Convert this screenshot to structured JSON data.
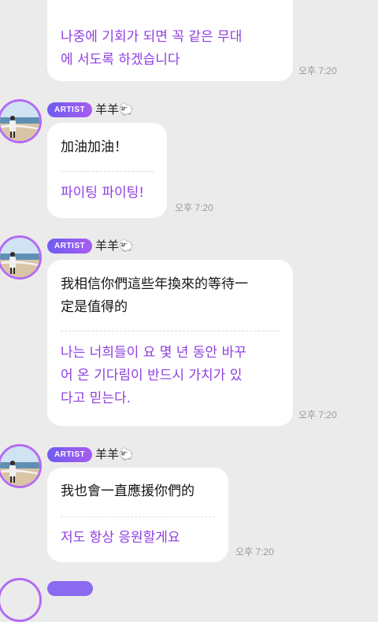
{
  "messages": [
    {
      "original": "",
      "translation": "나중에 기회가 되면 꼭 같은 무대\n에 서도록 하겠습니다",
      "time": "오후 7:20"
    },
    {
      "artist_badge": "ARTIST",
      "name": "羊羊🐑",
      "original": "加油加油！",
      "translation": "파이팅 파이팅!",
      "time": "오후 7:20"
    },
    {
      "artist_badge": "ARTIST",
      "name": "羊羊🐑",
      "original": "我相信你們這些年換來的等待一\n定是值得的",
      "translation": "나는 너희들이 요 몇 년 동안 바꾸\n어 온 기다림이 반드시 가치가 있\n다고 믿는다.",
      "time": "오후 7:20"
    },
    {
      "artist_badge": "ARTIST",
      "name": "羊羊🐑",
      "original": "我也會一直應援你們的",
      "translation": "저도 항상 응원할게요",
      "time": "오후 7:20"
    }
  ],
  "colors": {
    "background": "#ebebeb",
    "translation_text": "#8f3ee0",
    "avatar_ring": "#b46bf2",
    "badge_gradient_start": "#6d5cf0",
    "badge_gradient_end": "#a95cf0"
  }
}
